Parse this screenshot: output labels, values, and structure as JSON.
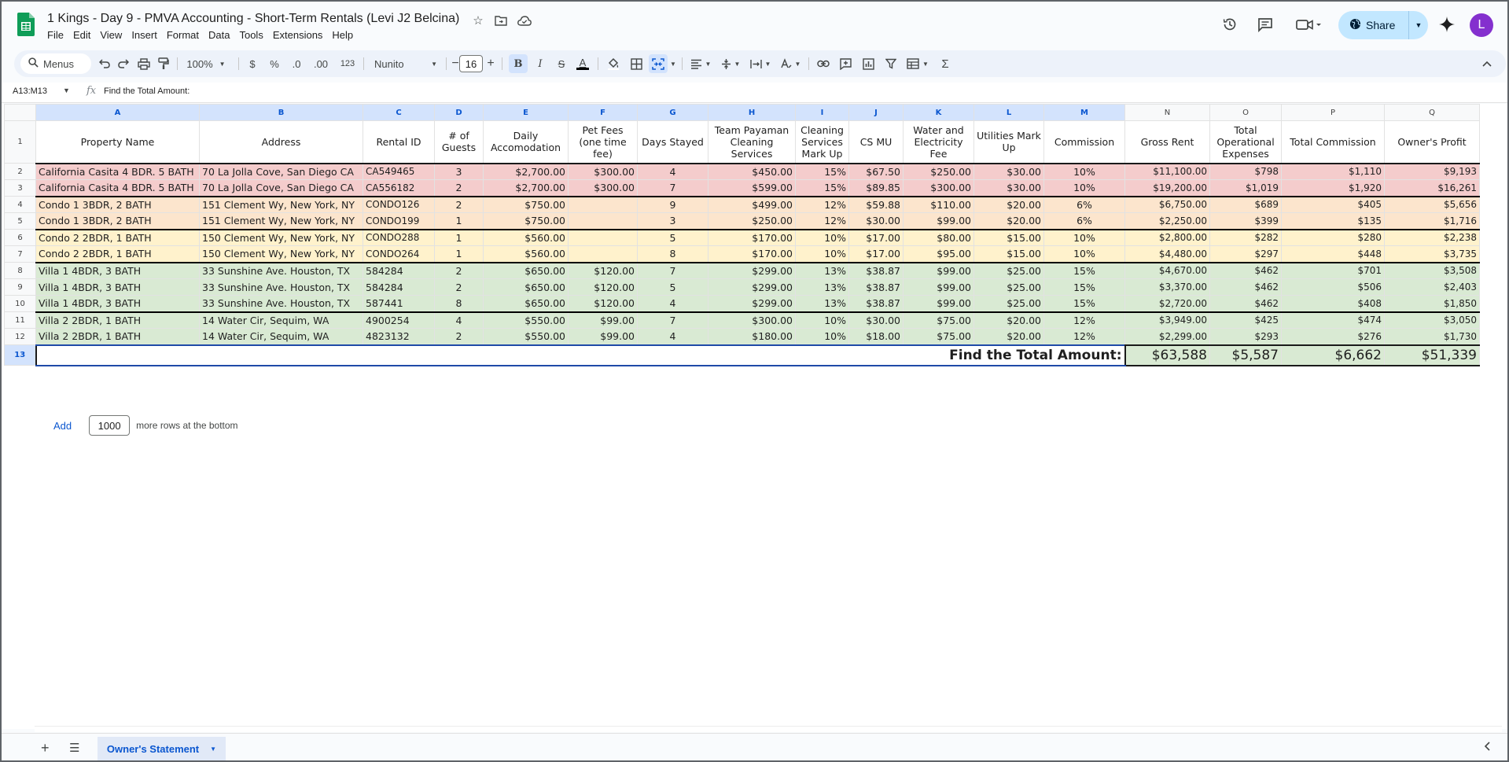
{
  "app": {
    "title": "1 Kings - Day 9 - PMVA Accounting - Short-Term Rentals (Levi J2 Belcina)",
    "menus": [
      "File",
      "Edit",
      "View",
      "Insert",
      "Format",
      "Data",
      "Tools",
      "Extensions",
      "Help"
    ],
    "share_label": "Share",
    "avatar_letter": "L"
  },
  "toolbar": {
    "search_label": "Menus",
    "zoom": "100%",
    "currency": "$",
    "percent": "%",
    "dec_decrease": ".0",
    "dec_increase": ".00",
    "number_format": "123",
    "font": "Nunito",
    "font_size": "16",
    "bold": "B",
    "italic": "I",
    "sigma": "Σ",
    "text_color_glyph": "A"
  },
  "formula_bar": {
    "name_box": "A13:M13",
    "fx": "fx",
    "formula": "Find the Total Amount:"
  },
  "columns": [
    "A",
    "B",
    "C",
    "D",
    "E",
    "F",
    "G",
    "H",
    "I",
    "J",
    "K",
    "L",
    "M",
    "N",
    "O",
    "P",
    "Q"
  ],
  "header_row": [
    "Property Name",
    "Address",
    "Rental ID",
    "# of Guests",
    "Daily Accomodation",
    "Pet Fees (one time fee)",
    "Days Stayed",
    "Team Payaman Cleaning Services",
    "Cleaning Services Mark Up",
    "CS MU",
    "Water and Electricity Fee",
    "Utilities Mark Up",
    "Commission",
    "Gross Rent",
    "Total Operational Expenses",
    "Total Commission",
    "Owner's Profit"
  ],
  "rows": [
    {
      "num": "2",
      "color": "red",
      "top": false,
      "cells": [
        "California Casita 4 BDR. 5 BATH",
        "70 La Jolla Cove, San Diego CA",
        "CA549465",
        "3",
        "$2,700.00",
        "$300.00",
        "4",
        "$450.00",
        "15%",
        "$67.50",
        "$250.00",
        "$30.00",
        "10%",
        "$11,100.00",
        "$798",
        "$1,110",
        "$9,193"
      ]
    },
    {
      "num": "3",
      "color": "red",
      "top": false,
      "cells": [
        "California Casita 4 BDR. 5 BATH",
        "70 La Jolla Cove, San Diego CA",
        "CA556182",
        "2",
        "$2,700.00",
        "$300.00",
        "7",
        "$599.00",
        "15%",
        "$89.85",
        "$300.00",
        "$30.00",
        "10%",
        "$19,200.00",
        "$1,019",
        "$1,920",
        "$16,261"
      ]
    },
    {
      "num": "4",
      "color": "orange",
      "top": true,
      "cells": [
        "Condo 1 3BDR, 2 BATH",
        "151 Clement Wy, New York, NY",
        "CONDO126",
        "2",
        "$750.00",
        "",
        "9",
        "$499.00",
        "12%",
        "$59.88",
        "$110.00",
        "$20.00",
        "6%",
        "$6,750.00",
        "$689",
        "$405",
        "$5,656"
      ]
    },
    {
      "num": "5",
      "color": "orange",
      "top": false,
      "cells": [
        "Condo 1 3BDR, 2 BATH",
        "151 Clement Wy, New York, NY",
        "CONDO199",
        "1",
        "$750.00",
        "",
        "3",
        "$250.00",
        "12%",
        "$30.00",
        "$99.00",
        "$20.00",
        "6%",
        "$2,250.00",
        "$399",
        "$135",
        "$1,716"
      ]
    },
    {
      "num": "6",
      "color": "yellow",
      "top": true,
      "cells": [
        "Condo 2 2BDR, 1 BATH",
        "150 Clement Wy, New York, NY",
        "CONDO288",
        "1",
        "$560.00",
        "",
        "5",
        "$170.00",
        "10%",
        "$17.00",
        "$80.00",
        "$15.00",
        "10%",
        "$2,800.00",
        "$282",
        "$280",
        "$2,238"
      ]
    },
    {
      "num": "7",
      "color": "yellow",
      "top": false,
      "cells": [
        "Condo 2 2BDR, 1 BATH",
        "150 Clement Wy, New York, NY",
        "CONDO264",
        "1",
        "$560.00",
        "",
        "8",
        "$170.00",
        "10%",
        "$17.00",
        "$95.00",
        "$15.00",
        "10%",
        "$4,480.00",
        "$297",
        "$448",
        "$3,735"
      ]
    },
    {
      "num": "8",
      "color": "green",
      "top": true,
      "cells": [
        "Villa 1  4BDR, 3 BATH",
        "33 Sunshine Ave. Houston, TX",
        "584284",
        "2",
        "$650.00",
        "$120.00",
        "7",
        "$299.00",
        "13%",
        "$38.87",
        "$99.00",
        "$25.00",
        "15%",
        "$4,670.00",
        "$462",
        "$701",
        "$3,508"
      ]
    },
    {
      "num": "9",
      "color": "green",
      "top": false,
      "cells": [
        "Villa 1  4BDR, 3 BATH",
        "33 Sunshine Ave. Houston, TX",
        "584284",
        "2",
        "$650.00",
        "$120.00",
        "5",
        "$299.00",
        "13%",
        "$38.87",
        "$99.00",
        "$25.00",
        "15%",
        "$3,370.00",
        "$462",
        "$506",
        "$2,403"
      ]
    },
    {
      "num": "10",
      "color": "green",
      "top": false,
      "cells": [
        "Villa 1  4BDR, 3 BATH",
        "33 Sunshine Ave. Houston, TX",
        "587441",
        "8",
        "$650.00",
        "$120.00",
        "4",
        "$299.00",
        "13%",
        "$38.87",
        "$99.00",
        "$25.00",
        "15%",
        "$2,720.00",
        "$462",
        "$408",
        "$1,850"
      ]
    },
    {
      "num": "11",
      "color": "green",
      "top": true,
      "cells": [
        "Villa 2 2BDR, 1 BATH",
        "14 Water Cir, Sequim, WA",
        "4900254",
        "4",
        "$550.00",
        "$99.00",
        "7",
        "$300.00",
        "10%",
        "$30.00",
        "$75.00",
        "$20.00",
        "12%",
        "$3,949.00",
        "$425",
        "$474",
        "$3,050"
      ]
    },
    {
      "num": "12",
      "color": "green",
      "top": false,
      "cells": [
        "Villa 2 2BDR, 1 BATH",
        "14 Water Cir, Sequim, WA",
        "4823132",
        "2",
        "$550.00",
        "$99.00",
        "4",
        "$180.00",
        "10%",
        "$18.00",
        "$75.00",
        "$20.00",
        "12%",
        "$2,299.00",
        "$293",
        "$276",
        "$1,730"
      ]
    }
  ],
  "total_row": {
    "num": "13",
    "label": "Find the Total Amount:",
    "values": [
      "$63,588",
      "$5,587",
      "$6,662",
      "$51,339"
    ]
  },
  "add_rows": {
    "button": "Add",
    "count": "1000",
    "suffix": "more rows at the bottom"
  },
  "sheet_tab": {
    "name": "Owner's Statement"
  },
  "colors": {
    "red_group": "#f4cccc",
    "orange_group": "#fce5cd",
    "yellow_group": "#fff2cc",
    "green_group": "#d9ead3",
    "share_bg": "#c2e7ff",
    "avatar": "#8430ce"
  }
}
